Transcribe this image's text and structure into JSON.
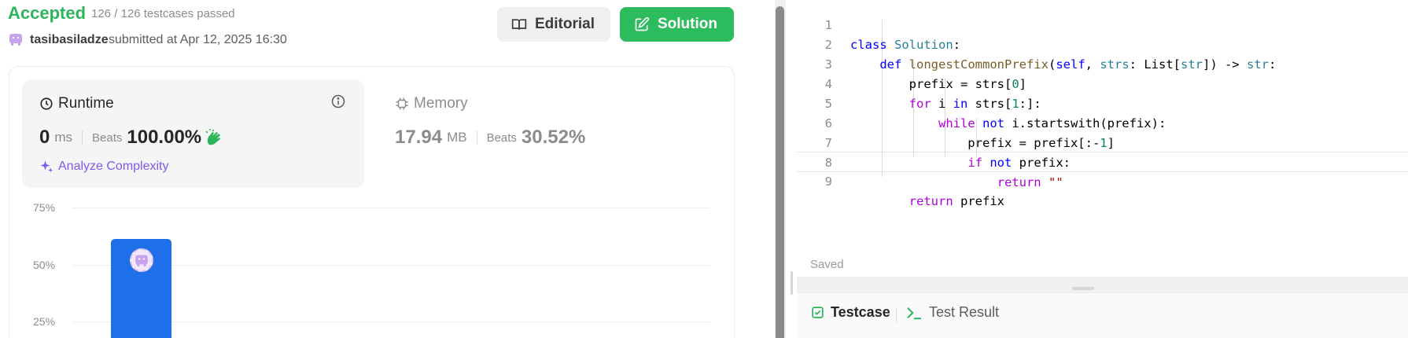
{
  "submission": {
    "status": "Accepted",
    "testcases": "126 / 126 testcases passed",
    "username": "tasibasiladze",
    "submitted_text": "submitted at Apr 12, 2025 16:30"
  },
  "buttons": {
    "editorial": "Editorial",
    "solution": "Solution"
  },
  "runtime": {
    "title": "Runtime",
    "value": "0",
    "unit": "ms",
    "beats_label": "Beats",
    "beats_value": "100.00%",
    "analyze": "Analyze Complexity"
  },
  "memory": {
    "title": "Memory",
    "value": "17.94",
    "unit": "MB",
    "beats_label": "Beats",
    "beats_value": "30.52%"
  },
  "chart": {
    "ylabels": [
      "75%",
      "50%",
      "25%"
    ]
  },
  "chart_data": {
    "type": "bar",
    "ylim": [
      0,
      75
    ],
    "yticks": [
      "75%",
      "50%",
      "25%"
    ],
    "values": [
      61
    ],
    "grid": true
  },
  "editor": {
    "lines": [
      "class Solution:",
      "    def longestCommonPrefix(self, strs: List[str]) -> str:",
      "        prefix = strs[0]",
      "        for i in strs[1:]:",
      "            while not i.startswith(prefix):",
      "                prefix = prefix[:-1]",
      "                if not prefix:",
      "                    return \"\"",
      "        return prefix"
    ],
    "status": "Saved"
  },
  "tabs": {
    "testcase": "Testcase",
    "test_result": "Test Result"
  },
  "colors": {
    "accent_green": "#2db55d",
    "bar_blue": "#1f6fe8",
    "analyze_purple": "#7c5cf0"
  }
}
